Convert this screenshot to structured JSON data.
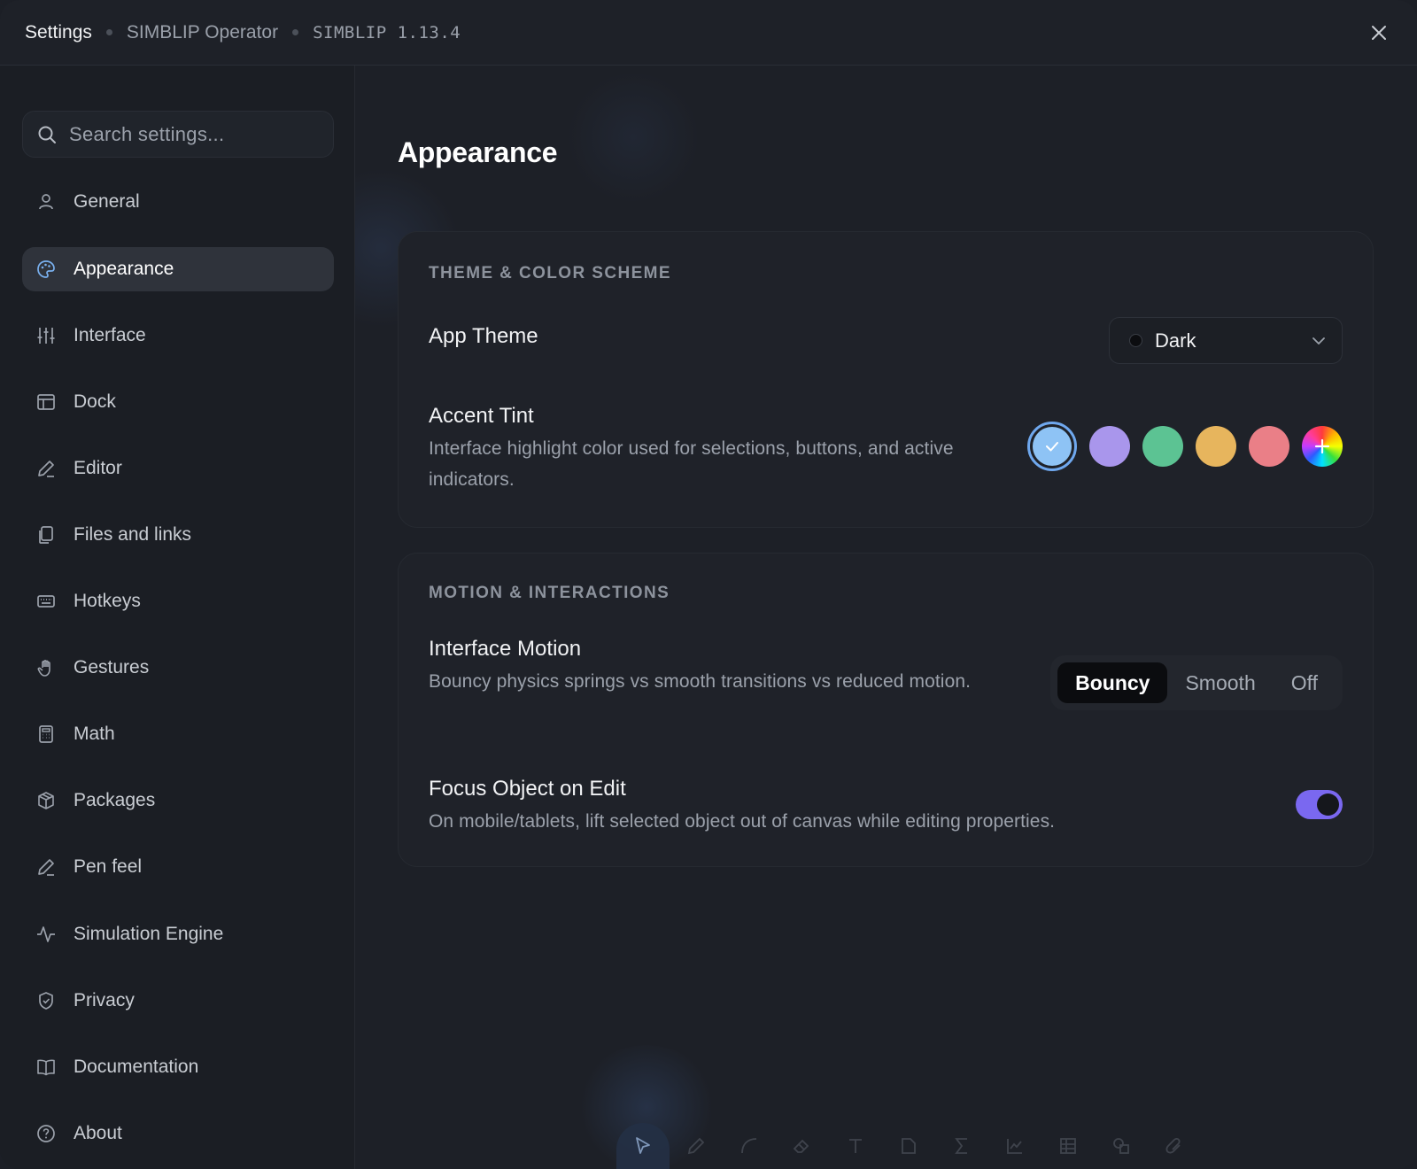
{
  "titlebar": {
    "title": "Settings",
    "app_name": "SIMBLIP Operator",
    "version": "SIMBLIP 1.13.4"
  },
  "search": {
    "placeholder": "Search settings..."
  },
  "sidebar": {
    "items": [
      {
        "label": "General",
        "icon": "user-icon",
        "active": false
      },
      {
        "label": "Appearance",
        "icon": "palette-icon",
        "active": true
      },
      {
        "label": "Interface",
        "icon": "sliders-icon",
        "active": false
      },
      {
        "label": "Dock",
        "icon": "layout-icon",
        "active": false
      },
      {
        "label": "Editor",
        "icon": "pen-icon",
        "active": false
      },
      {
        "label": "Files and links",
        "icon": "files-icon",
        "active": false
      },
      {
        "label": "Hotkeys",
        "icon": "keyboard-icon",
        "active": false
      },
      {
        "label": "Gestures",
        "icon": "hand-icon",
        "active": false
      },
      {
        "label": "Math",
        "icon": "calculator-icon",
        "active": false
      },
      {
        "label": "Packages",
        "icon": "package-icon",
        "active": false
      },
      {
        "label": "Pen feel",
        "icon": "pen-icon",
        "active": false
      },
      {
        "label": "Simulation Engine",
        "icon": "activity-icon",
        "active": false
      },
      {
        "label": "Privacy",
        "icon": "shield-icon",
        "active": false
      },
      {
        "label": "Documentation",
        "icon": "book-icon",
        "active": false
      },
      {
        "label": "About",
        "icon": "help-circle-icon",
        "active": false
      }
    ]
  },
  "main": {
    "title": "Appearance",
    "theme_section": {
      "heading": "THEME & COLOR SCHEME",
      "app_theme": {
        "label": "App Theme",
        "value": "Dark"
      },
      "accent_tint": {
        "label": "Accent Tint",
        "description": "Interface highlight color used for selections, buttons, and active indicators.",
        "swatches": [
          "#8ec3f5",
          "#a996ec",
          "#5cc393",
          "#e7b55d",
          "#ea7f87"
        ],
        "selected_index": 0
      }
    },
    "motion_section": {
      "heading": "MOTION & INTERACTIONS",
      "interface_motion": {
        "label": "Interface Motion",
        "description": "Bouncy physics springs vs smooth transitions vs reduced motion.",
        "options": [
          "Bouncy",
          "Smooth",
          "Off"
        ],
        "selected": "Bouncy"
      },
      "focus_object": {
        "label": "Focus Object on Edit",
        "description": "On mobile/tablets, lift selected object out of canvas while editing properties.",
        "enabled": true
      }
    }
  },
  "colors": {
    "accent_toggle": "#7a68f0",
    "selected_ring": "#6fa8ee",
    "background": "#1d2027"
  },
  "bottom_toolbar": {
    "tools": [
      "pointer-icon",
      "pencil-icon",
      "curve-icon",
      "eraser-icon",
      "text-icon",
      "note-icon",
      "sigma-icon",
      "chart-icon",
      "table-icon",
      "shapes-icon",
      "attachment-icon"
    ],
    "active_index": 0
  }
}
